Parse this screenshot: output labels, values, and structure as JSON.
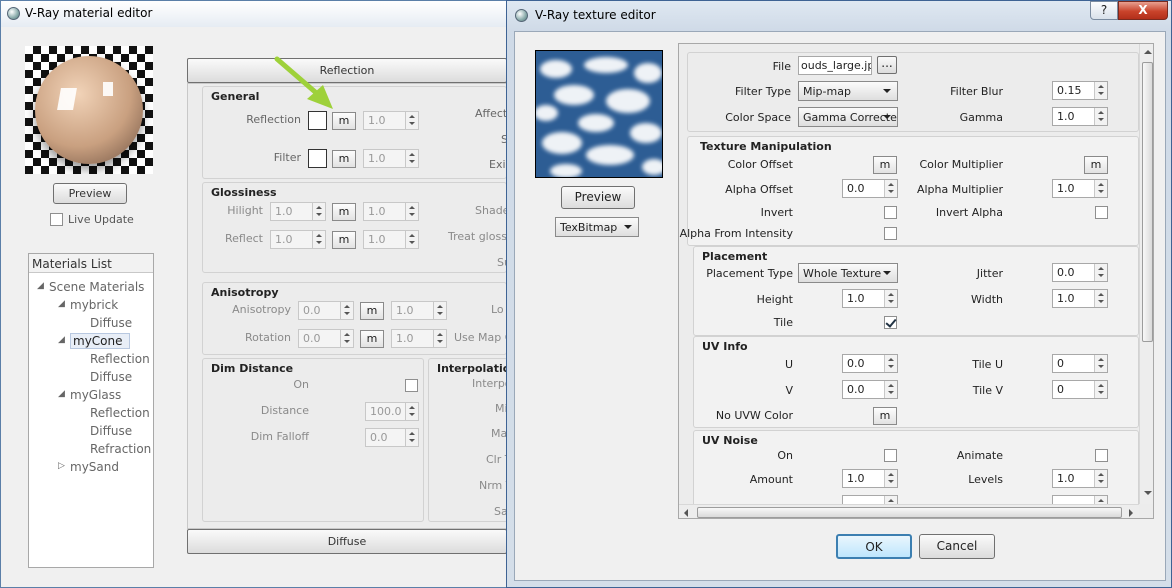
{
  "material_editor": {
    "title": "V-Ray material editor",
    "preview_label": "Preview",
    "live_update_label": "Live Update",
    "materials_list_title": "Materials List",
    "tree": {
      "root": "Scene Materials",
      "items": [
        {
          "label": "mybrick",
          "level": 1,
          "children": [
            "Diffuse"
          ]
        },
        {
          "label": "myCone",
          "level": 1,
          "selected": true,
          "children": [
            "Reflection",
            "Diffuse"
          ]
        },
        {
          "label": "myGlass",
          "level": 1,
          "children": [
            "Reflection",
            "Diffuse",
            "Refraction"
          ]
        },
        {
          "label": "mySand",
          "level": 1,
          "collapsed": true,
          "children": []
        }
      ]
    },
    "rollout_reflection": "Reflection",
    "rollout_diffuse": "Diffuse",
    "general": {
      "title": "General",
      "reflection_label": "Reflection",
      "reflection_value": "1.0",
      "filter_label": "Filter",
      "filter_value": "1.0",
      "map_label": "m",
      "right_labels": [
        "Affect",
        "S",
        "Exi"
      ]
    },
    "glossiness": {
      "title": "Glossiness",
      "hilight_label": "Hilight",
      "hilight_value": "1.0",
      "hilight_value2": "1.0",
      "reflect_label": "Reflect",
      "reflect_value": "1.0",
      "reflect_value2": "1.0",
      "right_labels": [
        "Shade",
        "Treat glossy",
        "Su"
      ]
    },
    "anisotropy": {
      "title": "Anisotropy",
      "anisotropy_label": "Anisotropy",
      "anisotropy_value": "0.0",
      "anisotropy_value2": "1.0",
      "rotation_label": "Rotation",
      "rotation_value": "0.0",
      "rotation_value2": "1.0",
      "right_labels": [
        "Lo",
        "Use Map C"
      ]
    },
    "dim_distance": {
      "title": "Dim Distance",
      "on_label": "On",
      "distance_label": "Distance",
      "distance_value": "100.0",
      "dim_falloff_label": "Dim Falloff",
      "dim_falloff_value": "0.0"
    },
    "interpolation": {
      "title": "Interpolation",
      "labels": [
        "Interpo",
        "Mi",
        "Ma",
        "Clr T",
        "Nrm T",
        "Sa"
      ]
    }
  },
  "texture_editor": {
    "title": "V-Ray texture editor",
    "help_label": "?",
    "close_label": "X",
    "preview_label": "Preview",
    "texture_type": "TexBitmap",
    "file": {
      "label": "File",
      "value": "ouds_large.jpg",
      "browse_label": "..."
    },
    "filter_type": {
      "label": "Filter Type",
      "value": "Mip-map"
    },
    "filter_blur": {
      "label": "Filter Blur",
      "value": "0.15"
    },
    "color_space": {
      "label": "Color Space",
      "value": "Gamma Corrected"
    },
    "gamma": {
      "label": "Gamma",
      "value": "1.0"
    },
    "texture_manipulation": {
      "title": "Texture Manipulation",
      "color_offset_label": "Color Offset",
      "color_multiplier_label": "Color Multiplier",
      "alpha_offset_label": "Alpha Offset",
      "alpha_offset_value": "0.0",
      "alpha_multiplier_label": "Alpha Multiplier",
      "alpha_multiplier_value": "1.0",
      "invert_label": "Invert",
      "invert_alpha_label": "Invert Alpha",
      "alpha_from_intensity_label": "Alpha From Intensity",
      "map_label": "m"
    },
    "placement": {
      "title": "Placement",
      "placement_type_label": "Placement Type",
      "placement_type_value": "Whole Texture",
      "jitter_label": "Jitter",
      "jitter_value": "0.0",
      "height_label": "Height",
      "height_value": "1.0",
      "width_label": "Width",
      "width_value": "1.0",
      "tile_label": "Tile"
    },
    "uv_info": {
      "title": "UV Info",
      "u_label": "U",
      "u_value": "0.0",
      "tile_u_label": "Tile U",
      "tile_u_value": "0",
      "v_label": "V",
      "v_value": "0.0",
      "tile_v_label": "Tile V",
      "tile_v_value": "0",
      "no_uvw_color_label": "No UVW Color",
      "map_label": "m"
    },
    "uv_noise": {
      "title": "UV Noise",
      "on_label": "On",
      "animate_label": "Animate",
      "amount_label": "Amount",
      "amount_value": "1.0",
      "levels_label": "Levels",
      "levels_value": "1.0"
    },
    "ok_label": "OK",
    "cancel_label": "Cancel"
  }
}
